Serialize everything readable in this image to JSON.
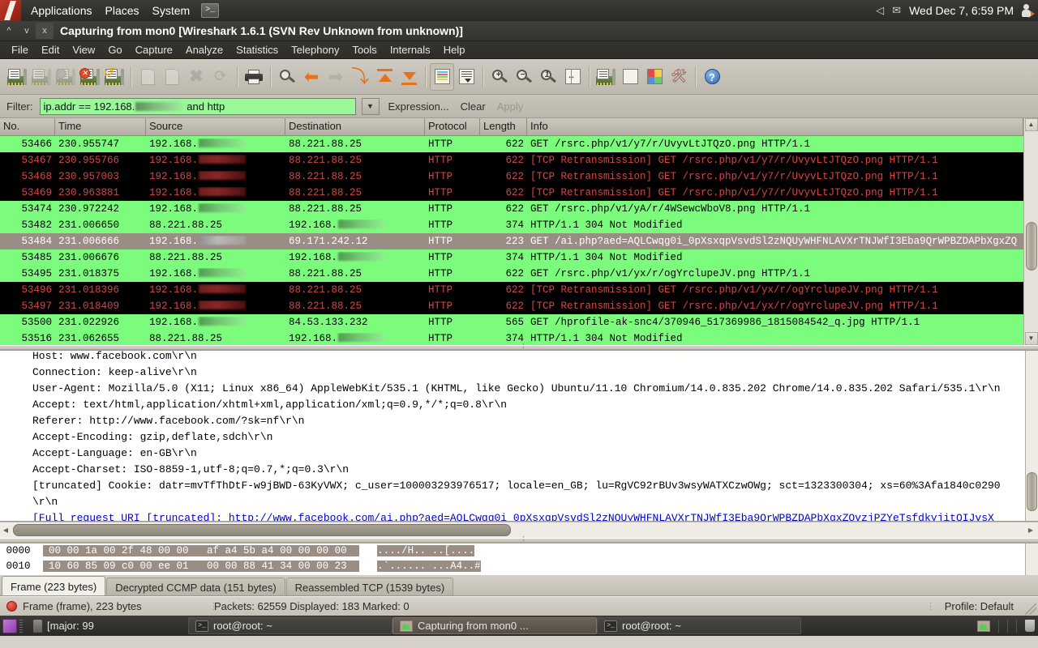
{
  "gnome_panel": {
    "logo_name": "ubuntu-logo",
    "menus": [
      "Applications",
      "Places",
      "System"
    ],
    "terminal_icon": ">_",
    "volume_icon": "speaker-icon",
    "mail_icon": "envelope-icon",
    "clock": "Wed Dec  7,  6:59 PM",
    "user_icon": "user-logout-icon"
  },
  "window": {
    "minimize": "^",
    "maximize": "v",
    "close": "x",
    "title": "Capturing from mon0    [Wireshark 1.6.1  (SVN Rev Unknown from unknown)]"
  },
  "menubar": {
    "items": [
      "File",
      "Edit",
      "View",
      "Go",
      "Capture",
      "Analyze",
      "Statistics",
      "Telephony",
      "Tools",
      "Internals",
      "Help"
    ]
  },
  "toolbar": {
    "buttons": [
      {
        "name": "interfaces-list",
        "icon": "network-card-icon",
        "enabled": true
      },
      {
        "name": "capture-options",
        "icon": "network-card-options-icon",
        "enabled": false
      },
      {
        "name": "start-capture",
        "icon": "network-card-start-icon",
        "enabled": false
      },
      {
        "name": "stop-capture",
        "icon": "network-card-stop-icon",
        "enabled": true
      },
      {
        "name": "restart-capture",
        "icon": "network-card-restart-icon",
        "enabled": true
      },
      {
        "name": "open-file",
        "icon": "open-document-icon",
        "enabled": false
      },
      {
        "name": "save-file",
        "icon": "save-document-icon",
        "enabled": false
      },
      {
        "name": "close-file",
        "icon": "close-x-icon",
        "enabled": false
      },
      {
        "name": "reload-file",
        "icon": "reload-icon",
        "enabled": false
      },
      {
        "name": "print",
        "icon": "printer-icon",
        "enabled": true
      },
      {
        "name": "find-packet",
        "icon": "magnifier-icon",
        "enabled": true
      },
      {
        "name": "go-back",
        "icon": "arrow-left-icon",
        "enabled": true
      },
      {
        "name": "go-forward",
        "icon": "arrow-right-icon",
        "enabled": false
      },
      {
        "name": "go-to-packet",
        "icon": "arrow-jump-icon",
        "enabled": true
      },
      {
        "name": "go-to-first-packet",
        "icon": "arrow-up-bar-icon",
        "enabled": true
      },
      {
        "name": "go-to-last-packet",
        "icon": "arrow-down-bar-icon",
        "enabled": true
      },
      {
        "name": "colorize-packet-list",
        "icon": "colorize-icon",
        "enabled": true,
        "active": true
      },
      {
        "name": "auto-scroll-live-capture",
        "icon": "auto-scroll-icon",
        "enabled": true
      },
      {
        "name": "zoom-in",
        "icon": "zoom-in-icon",
        "enabled": true
      },
      {
        "name": "zoom-out",
        "icon": "zoom-out-icon",
        "enabled": true
      },
      {
        "name": "zoom-100",
        "icon": "zoom-reset-icon",
        "enabled": true
      },
      {
        "name": "resize-columns",
        "icon": "resize-columns-icon",
        "enabled": true
      },
      {
        "name": "capture-filters",
        "icon": "capture-filter-icon",
        "enabled": true
      },
      {
        "name": "display-filters",
        "icon": "display-filter-icon",
        "enabled": true
      },
      {
        "name": "coloring-rules",
        "icon": "coloring-rules-icon",
        "enabled": true
      },
      {
        "name": "preferences",
        "icon": "wrench-screwdriver-icon",
        "enabled": true
      },
      {
        "name": "help",
        "icon": "help-question-icon",
        "enabled": true
      }
    ]
  },
  "filterbar": {
    "label": "Filter:",
    "value_prefix": "ip.addr == 192.168.",
    "value_suffix": " and http",
    "value_redacted": true,
    "dropdown_icon": "chevron-down-icon",
    "expression_label": "Expression...",
    "clear_label": "Clear",
    "apply_label": "Apply",
    "apply_enabled": false
  },
  "packet_list": {
    "columns": [
      "No.",
      "Time",
      "Source",
      "Destination",
      "Protocol",
      "Length",
      "Info"
    ],
    "rows": [
      {
        "no": "53466",
        "time": "230.955747",
        "src": "192.168.",
        "src_redacted": true,
        "dst": "88.221.88.25",
        "dst_redacted": false,
        "proto": "HTTP",
        "len": "622",
        "info": "GET /rsrc.php/v1/y7/r/UvyvLtJTQzO.png HTTP/1.1",
        "style": "green"
      },
      {
        "no": "53467",
        "time": "230.955766",
        "src": "192.168.",
        "src_redacted": true,
        "dst": "88.221.88.25",
        "dst_redacted": false,
        "proto": "HTTP",
        "len": "622",
        "info": "[TCP Retransmission] GET /rsrc.php/v1/y7/r/UvyvLtJTQzO.png HTTP/1.1",
        "style": "black"
      },
      {
        "no": "53468",
        "time": "230.957003",
        "src": "192.168.",
        "src_redacted": true,
        "dst": "88.221.88.25",
        "dst_redacted": false,
        "proto": "HTTP",
        "len": "622",
        "info": "[TCP Retransmission] GET /rsrc.php/v1/y7/r/UvyvLtJTQzO.png HTTP/1.1",
        "style": "black"
      },
      {
        "no": "53469",
        "time": "230.963881",
        "src": "192.168.",
        "src_redacted": true,
        "dst": "88.221.88.25",
        "dst_redacted": false,
        "proto": "HTTP",
        "len": "622",
        "info": "[TCP Retransmission] GET /rsrc.php/v1/y7/r/UvyvLtJTQzO.png HTTP/1.1",
        "style": "black"
      },
      {
        "no": "53474",
        "time": "230.972242",
        "src": "192.168.",
        "src_redacted": true,
        "dst": "88.221.88.25",
        "dst_redacted": false,
        "proto": "HTTP",
        "len": "622",
        "info": "GET /rsrc.php/v1/yA/r/4WSewcWboV8.png HTTP/1.1",
        "style": "green"
      },
      {
        "no": "53482",
        "time": "231.006650",
        "src": "88.221.88.25",
        "src_redacted": false,
        "dst": "192.168.",
        "dst_redacted": true,
        "proto": "HTTP",
        "len": "374",
        "info": "HTTP/1.1 304 Not Modified",
        "style": "green"
      },
      {
        "no": "53484",
        "time": "231.006666",
        "src": "192.168.",
        "src_redacted": true,
        "dst": "69.171.242.12",
        "dst_redacted": false,
        "proto": "HTTP",
        "len": "223",
        "info": "GET /ai.php?aed=AQLCwqg0i_0pXsxqpVsvdSl2zNQUyWHFNLAVXrTNJWfI3Eba9QrWPBZDAPbXgxZQ",
        "style": "sel"
      },
      {
        "no": "53485",
        "time": "231.006676",
        "src": "88.221.88.25",
        "src_redacted": false,
        "dst": "192.168.",
        "dst_redacted": true,
        "proto": "HTTP",
        "len": "374",
        "info": "HTTP/1.1 304 Not Modified",
        "style": "green"
      },
      {
        "no": "53495",
        "time": "231.018375",
        "src": "192.168.",
        "src_redacted": true,
        "dst": "88.221.88.25",
        "dst_redacted": false,
        "proto": "HTTP",
        "len": "622",
        "info": "GET /rsrc.php/v1/yx/r/ogYrclupeJV.png HTTP/1.1",
        "style": "green"
      },
      {
        "no": "53496",
        "time": "231.018396",
        "src": "192.168.",
        "src_redacted": true,
        "dst": "88.221.88.25",
        "dst_redacted": false,
        "proto": "HTTP",
        "len": "622",
        "info": "[TCP Retransmission] GET /rsrc.php/v1/yx/r/ogYrclupeJV.png HTTP/1.1",
        "style": "black"
      },
      {
        "no": "53497",
        "time": "231.018409",
        "src": "192.168.",
        "src_redacted": true,
        "dst": "88.221.88.25",
        "dst_redacted": false,
        "proto": "HTTP",
        "len": "622",
        "info": "[TCP Retransmission] GET /rsrc.php/v1/yx/r/ogYrclupeJV.png HTTP/1.1",
        "style": "black"
      },
      {
        "no": "53500",
        "time": "231.022926",
        "src": "192.168.",
        "src_redacted": true,
        "dst": "84.53.133.232",
        "dst_redacted": false,
        "proto": "HTTP",
        "len": "565",
        "info": "GET /hprofile-ak-snc4/370946_517369986_1815084542_q.jpg HTTP/1.1",
        "style": "green"
      },
      {
        "no": "53516",
        "time": "231.062655",
        "src": "88.221.88.25",
        "src_redacted": false,
        "dst": "192.168.",
        "dst_redacted": true,
        "proto": "HTTP",
        "len": "374",
        "info": "HTTP/1.1 304 Not Modified",
        "style": "green"
      }
    ]
  },
  "packet_details": {
    "lines": [
      {
        "text": "Host: www.facebook.com\\r\\n",
        "link": false,
        "clipped_top": true
      },
      {
        "text": "Connection: keep-alive\\r\\n",
        "link": false
      },
      {
        "text": "User-Agent: Mozilla/5.0 (X11; Linux x86_64) AppleWebKit/535.1 (KHTML, like Gecko) Ubuntu/11.10 Chromium/14.0.835.202 Chrome/14.0.835.202 Safari/535.1\\r\\n",
        "link": false
      },
      {
        "text": "Accept: text/html,application/xhtml+xml,application/xml;q=0.9,*/*;q=0.8\\r\\n",
        "link": false
      },
      {
        "text": "Referer: http://www.facebook.com/?sk=nf\\r\\n",
        "link": false
      },
      {
        "text": "Accept-Encoding: gzip,deflate,sdch\\r\\n",
        "link": false
      },
      {
        "text": "Accept-Language: en-GB\\r\\n",
        "link": false
      },
      {
        "text": "Accept-Charset: ISO-8859-1,utf-8;q=0.7,*;q=0.3\\r\\n",
        "link": false
      },
      {
        "text": "[truncated] Cookie: datr=mvTfThDtF-w9jBWD-63KyVWX; c_user=100003293976517; locale=en_GB; lu=RgVC92rBUv3wsyWATXCzwOWg; sct=1323300304; xs=60%3Afa1840c0290",
        "link": false
      },
      {
        "text": "\\r\\n",
        "link": false
      },
      {
        "text": "[Full request URI [truncated]: http://www.facebook.com/ai.php?aed=AQLCwqg0i_0pXsxqpVsvdSl2zNQUyWHFNLAVXrTNJWfI3Eba9QrWPBZDAPbXgxZQvzjPZYeTsfdkyjitQIJvsX",
        "link": true
      }
    ]
  },
  "hex_pane": {
    "rows": [
      {
        "offset": "0000",
        "hex_left": "00 00 1a 00 2f 48 00 00",
        "hex_right": "af a4 5b a4 00 00 00 00",
        "ascii": "..../H.. ..[....",
        "highlight": true
      },
      {
        "offset": "0010",
        "hex_left": "10 60 85 09 c0 00 ee 01",
        "hex_right": "00 00 88 41 34 00 00 23",
        "ascii": ".`...... ...A4..#",
        "highlight": true
      }
    ]
  },
  "byte_tabs": [
    {
      "label": "Frame (223 bytes)",
      "active": true
    },
    {
      "label": "Decrypted CCMP data (151 bytes)",
      "active": false
    },
    {
      "label": "Reassembled TCP (1539 bytes)",
      "active": false
    }
  ],
  "statusbar": {
    "expert_icon": "expert-info-error-icon",
    "field_info": "Frame (frame), 223 bytes",
    "packets_info": "Packets: 62559 Displayed: 183 Marked: 0",
    "profile": "Profile: Default"
  },
  "taskbar": {
    "show_desktop_icon": "show-desktop-icon",
    "tasks": [
      {
        "label": "[major: 99",
        "icon": "usb-drive-icon",
        "active": false
      },
      {
        "label": "root@root: ~",
        "icon": "terminal-icon",
        "active": false
      },
      {
        "label": "Capturing from mon0  ...",
        "icon": "wireshark-icon",
        "active": true
      },
      {
        "label": "root@root: ~",
        "icon": "terminal-icon",
        "active": false
      }
    ],
    "tray": [
      {
        "name": "wireshark-tray-icon"
      },
      {
        "name": "trash-icon"
      }
    ]
  },
  "colors": {
    "row_green": "#7cfc7c",
    "row_black_bg": "#000000",
    "row_black_fg": "#d24646",
    "row_selected_bg": "#9a8d84",
    "filter_valid_bg": "#9af79a",
    "accent_orange": "#e8711a"
  }
}
